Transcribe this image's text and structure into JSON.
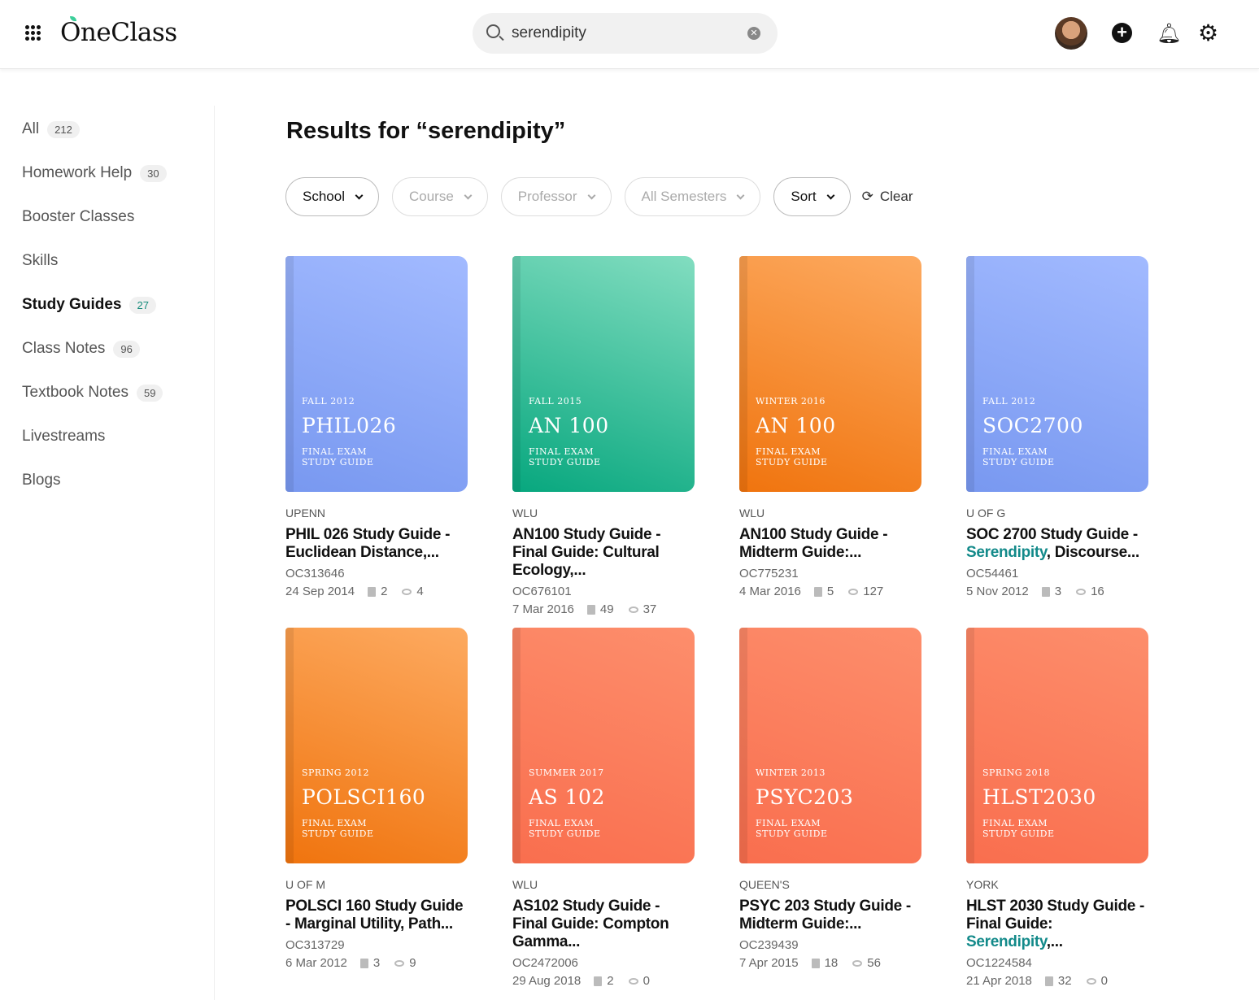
{
  "header": {
    "logo": "OneClass",
    "search_value": "serendipity"
  },
  "sidebar": {
    "items": [
      {
        "label": "All",
        "count": "212"
      },
      {
        "label": "Homework Help",
        "count": "30"
      },
      {
        "label": "Booster Classes",
        "count": null
      },
      {
        "label": "Skills",
        "count": null
      },
      {
        "label": "Study Guides",
        "count": "27"
      },
      {
        "label": "Class Notes",
        "count": "96"
      },
      {
        "label": "Textbook Notes",
        "count": "59"
      },
      {
        "label": "Livestreams",
        "count": null
      },
      {
        "label": "Blogs",
        "count": null
      }
    ]
  },
  "page_title": "Results for “serendipity”",
  "filters": {
    "school": "School",
    "course": "Course",
    "professor": "Professor",
    "semesters": "All Semesters",
    "sort": "Sort",
    "clear": "Clear"
  },
  "cards": [
    {
      "color": "blue",
      "semester": "FALL 2012",
      "code": "PHIL026",
      "kind1": "FINAL EXAM",
      "kind2": "STUDY GUIDE",
      "school": "UPENN",
      "t1": "PHIL 026 Study Guide - Euclidean Distance,...",
      "hl": "",
      "t2": "",
      "id": "OC313646",
      "date": "24 Sep 2014",
      "pages": "2",
      "views": "4"
    },
    {
      "color": "green",
      "semester": "FALL 2015",
      "code": "AN 100",
      "kind1": "FINAL EXAM",
      "kind2": "STUDY GUIDE",
      "school": "WLU",
      "t1": "AN100 Study Guide - Final Guide: Cultural Ecology,...",
      "hl": "",
      "t2": "",
      "id": "OC676101",
      "date": "7 Mar 2016",
      "pages": "49",
      "views": "37"
    },
    {
      "color": "orange",
      "semester": "WINTER 2016",
      "code": "AN 100",
      "kind1": "FINAL EXAM",
      "kind2": "STUDY GUIDE",
      "school": "WLU",
      "t1": "AN100 Study Guide - Midterm Guide:...",
      "hl": "",
      "t2": "",
      "id": "OC775231",
      "date": "4 Mar 2016",
      "pages": "5",
      "views": "127"
    },
    {
      "color": "blue",
      "semester": "FALL 2012",
      "code": "SOC2700",
      "kind1": "FINAL EXAM",
      "kind2": "STUDY GUIDE",
      "school": "U OF G",
      "t1": "SOC 2700 Study Guide - ",
      "hl": "Serendipity",
      "t2": ", Discourse...",
      "id": "OC54461",
      "date": "5 Nov 2012",
      "pages": "3",
      "views": "16"
    },
    {
      "color": "orange",
      "semester": "SPRING 2012",
      "code": "POLSCI160",
      "kind1": "FINAL EXAM",
      "kind2": "STUDY GUIDE",
      "school": "U OF M",
      "t1": "POLSCI 160 Study Guide - Marginal Utility, Path...",
      "hl": "",
      "t2": "",
      "id": "OC313729",
      "date": "6 Mar 2012",
      "pages": "3",
      "views": "9"
    },
    {
      "color": "red",
      "semester": "SUMMER 2017",
      "code": "AS 102",
      "kind1": "FINAL EXAM",
      "kind2": "STUDY GUIDE",
      "school": "WLU",
      "t1": "AS102 Study Guide - Final Guide: Compton Gamma...",
      "hl": "",
      "t2": "",
      "id": "OC2472006",
      "date": "29 Aug 2018",
      "pages": "2",
      "views": "0"
    },
    {
      "color": "red",
      "semester": "WINTER 2013",
      "code": "PSYC203",
      "kind1": "FINAL EXAM",
      "kind2": "STUDY GUIDE",
      "school": "QUEEN'S",
      "t1": "PSYC 203 Study Guide - Midterm Guide:...",
      "hl": "",
      "t2": "",
      "id": "OC239439",
      "date": "7 Apr 2015",
      "pages": "18",
      "views": "56"
    },
    {
      "color": "red",
      "semester": "SPRING 2018",
      "code": "HLST2030",
      "kind1": "FINAL EXAM",
      "kind2": "STUDY GUIDE",
      "school": "YORK",
      "t1": "HLST 2030 Study Guide - Final Guide: ",
      "hl": "Serendipity",
      "t2": ",...",
      "id": "OC1224584",
      "date": "21 Apr 2018",
      "pages": "32",
      "views": "0"
    }
  ]
}
